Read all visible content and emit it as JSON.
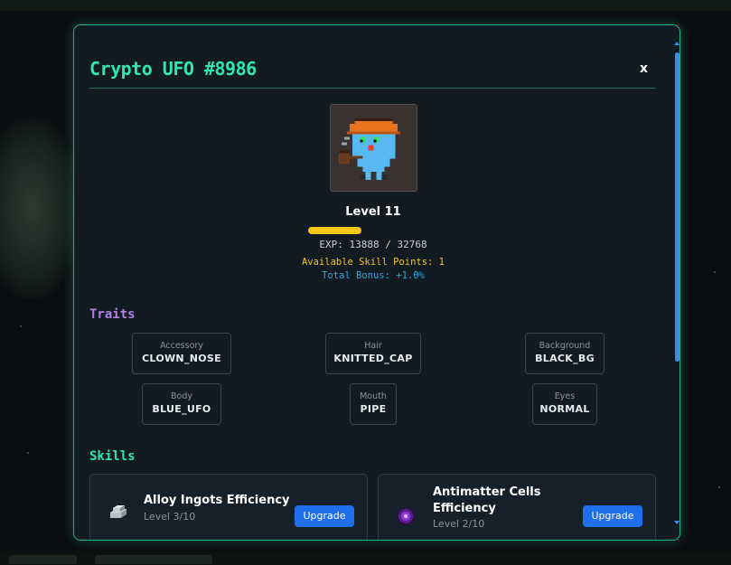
{
  "nft": {
    "title": "Crypto UFO #8986",
    "close_label": "x",
    "level_label": "Level 11",
    "exp_label": "EXP: 13888 / 32768",
    "exp_progress": 0.42,
    "skill_points_label": "Available Skill Points: 1",
    "total_bonus_label": "Total Bonus: +1.0%"
  },
  "traits": {
    "heading": "Traits",
    "items": [
      {
        "label": "Accessory",
        "value": "CLOWN_NOSE"
      },
      {
        "label": "Hair",
        "value": "KNITTED_CAP"
      },
      {
        "label": "Background",
        "value": "BLACK_BG"
      },
      {
        "label": "Body",
        "value": "BLUE_UFO"
      },
      {
        "label": "Mouth",
        "value": "PIPE"
      },
      {
        "label": "Eyes",
        "value": "NORMAL"
      }
    ]
  },
  "skills": {
    "heading": "Skills",
    "items": [
      {
        "name": "Alloy Ingots Efficiency",
        "level": "Level 3/10",
        "button": "Upgrade",
        "icon": "ingot-icon"
      },
      {
        "name": "Antimatter Cells Efficiency",
        "level": "Level 2/10",
        "button": "Upgrade",
        "icon": "antimatter-icon"
      }
    ]
  },
  "colors": {
    "accent": "#2ee6b0",
    "traits_heading": "#b77ee8",
    "exp_bar": "#f5c518",
    "bonus": "#2aa8e0",
    "button": "#1f6feb"
  }
}
